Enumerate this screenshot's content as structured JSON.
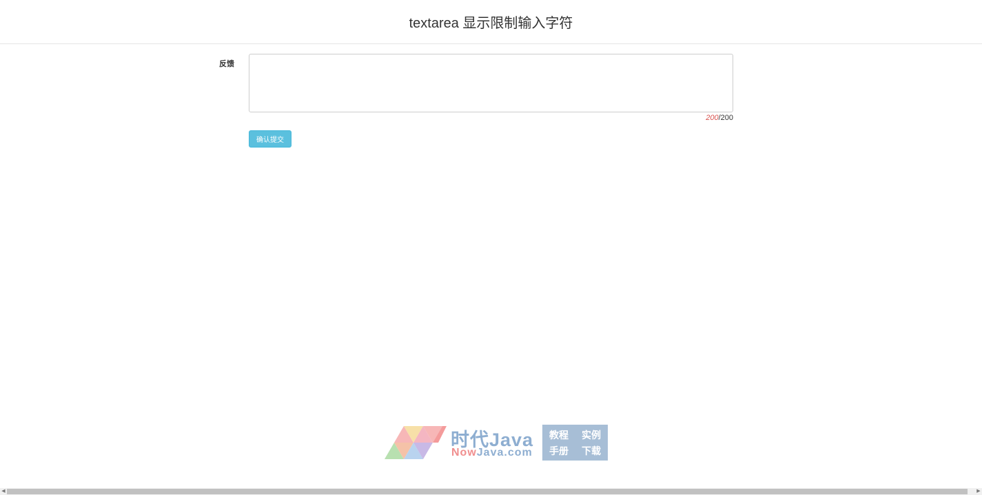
{
  "header": {
    "title": "textarea 显示限制输入字符"
  },
  "form": {
    "label": "反馈",
    "textarea_value": "",
    "counter_remaining": "200",
    "counter_separator": "/",
    "counter_total": "200",
    "submit_label": "确认提交"
  },
  "watermark": {
    "brand_cn": "时代Java",
    "brand_en_now": "Now",
    "brand_en_rest": "Java.com",
    "links": [
      "教程",
      "实例",
      "手册",
      "下载"
    ]
  },
  "colors": {
    "accent_button": "#5bc0de",
    "counter_remaining": "#d9534f",
    "watermark_blue": "#8eaed1",
    "watermark_box": "#a7bed6"
  }
}
